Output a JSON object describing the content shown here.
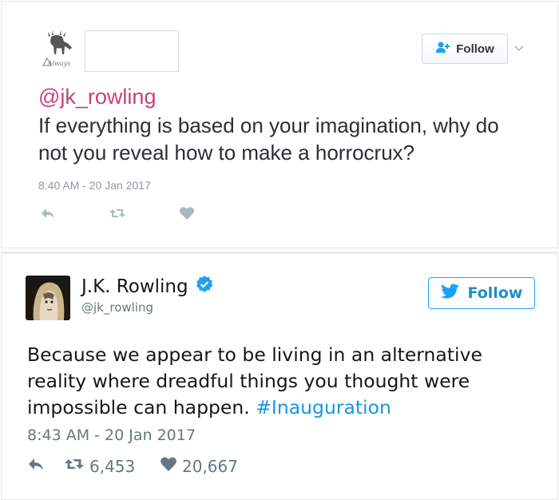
{
  "tweet1": {
    "follow_label": "Follow",
    "mention": "@jk_rowling",
    "text": "If everything is based on your imagination, why do not you reveal how to make a horrocrux?",
    "timestamp": "8:40 AM - 20 Jan 2017",
    "icons": [
      "deer-logo-icon",
      "add-user-icon",
      "chevron-down-icon",
      "reply-icon",
      "retweet-icon",
      "heart-icon"
    ]
  },
  "tweet2": {
    "name": "J.K. Rowling",
    "handle": "@jk_rowling",
    "follow_label": "Follow",
    "text_before": "Because we appear to be living in an alternative reality where dreadful things you thought were impossible can happen. ",
    "hashtag": "#Inauguration",
    "timestamp": "8:43 AM - 20 Jan 2017",
    "retweets": "6,453",
    "likes": "20,667",
    "icons": [
      "verified-badge-icon",
      "twitter-bird-icon",
      "reply-icon",
      "retweet-icon",
      "heart-icon"
    ]
  },
  "colors": {
    "mention": "#c8437e",
    "twitter_blue": "#1da1f2",
    "hashtag": "#1b95e0",
    "muted": "#657786"
  }
}
